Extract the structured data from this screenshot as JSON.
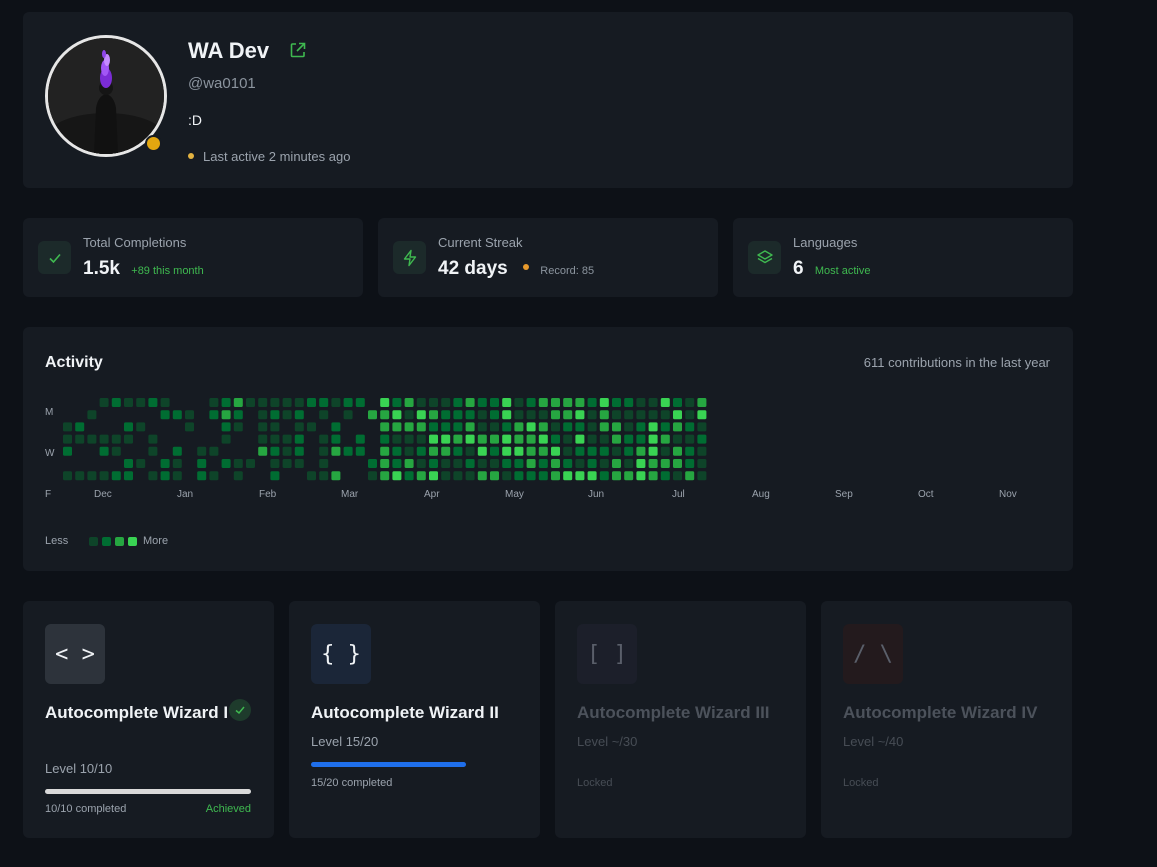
{
  "profile": {
    "name": "WA Dev",
    "handle": "@wa0101",
    "bio": ":D",
    "last_active": "Last active 2 minutes ago"
  },
  "stats": [
    {
      "label": "Total Completions",
      "value": "1.5k",
      "sub": "+89 this month",
      "icon": "check-icon"
    },
    {
      "label": "Current Streak",
      "value": "42 days",
      "sub": "Record: 85",
      "icon": "lightning-icon"
    },
    {
      "label": "Languages",
      "value": "6",
      "sub": "Most active",
      "icon": "layers-icon"
    }
  ],
  "activity": {
    "title": "Activity",
    "count": "611 contributions in the last year",
    "days": [
      "M",
      "W",
      "F"
    ],
    "months": [
      "Dec",
      "Jan",
      "Feb",
      "Mar",
      "Apr",
      "May",
      "Jun",
      "Jul",
      "Aug",
      "Sep",
      "Oct",
      "Nov"
    ],
    "legend_less": "Less",
    "legend_more": "More",
    "colors": [
      "#0e4429",
      "#006d32",
      "#26a641",
      "#39d353"
    ]
  },
  "achievements": [
    {
      "icon_text": "< >",
      "title": "Autocomplete Wizard I",
      "level": "Level 10/10",
      "progress": 1.0,
      "footer": "10/10 completed",
      "status": "Achieved",
      "state": "achieved"
    },
    {
      "icon_text": "{ }",
      "title": "Autocomplete Wizard II",
      "level": "Level 15/20",
      "progress": 0.75,
      "footer": "15/20 completed",
      "status": "",
      "state": "active"
    },
    {
      "icon_text": "[ ]",
      "title": "Autocomplete Wizard III",
      "level": "Level ~/30",
      "progress": 0,
      "footer": "Locked",
      "status": "",
      "state": "locked"
    },
    {
      "icon_text": "/ \\",
      "title": "Autocomplete Wizard IV",
      "level": "Level ~/40",
      "progress": 0,
      "footer": "Locked",
      "status": "",
      "state": "locked"
    }
  ]
}
